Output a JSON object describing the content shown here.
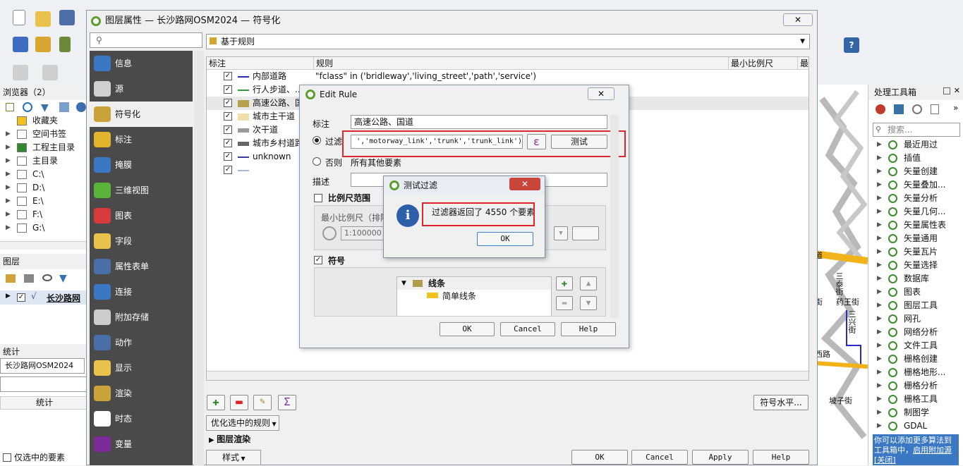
{
  "browser": {
    "title": "浏览器（2）",
    "items": [
      {
        "label": "收藏夹"
      },
      {
        "label": "空间书签"
      },
      {
        "label": "工程主目录"
      },
      {
        "label": "主目录"
      },
      {
        "label": "C:\\"
      },
      {
        "label": "D:\\"
      },
      {
        "label": "E:\\"
      },
      {
        "label": "F:\\"
      },
      {
        "label": "G:\\"
      }
    ]
  },
  "layers": {
    "title": "图层",
    "layer_name": "长沙路网"
  },
  "stats": {
    "title": "统计",
    "layer": "长沙路网OSM2024",
    "column": "统计",
    "only_selected": "仅选中的要素"
  },
  "toolbox": {
    "title": "处理工具箱",
    "search_placeholder": "搜索...",
    "items": [
      "最近用过",
      "插值",
      "矢量创建",
      "矢量叠加...",
      "矢量分析",
      "矢量几何...",
      "矢量属性表",
      "矢量通用",
      "矢量瓦片",
      "矢量选择",
      "数据库",
      "图表",
      "图层工具",
      "网孔",
      "网络分析",
      "文件工具",
      "栅格创建",
      "栅格地形...",
      "栅格分析",
      "栅格工具",
      "制图学",
      "GDAL"
    ],
    "note": "你可以添加更多算法到工具箱中，",
    "note_link": "启用附加源",
    "note_close": "[关闭]"
  },
  "map": {
    "labels": [
      "道",
      "三泰街",
      "药王街",
      "三兴街",
      "街",
      "西路",
      "坡子街"
    ]
  },
  "props": {
    "title": "图层属性 — 长沙路网OSM2024 — 符号化",
    "close": "✕",
    "renderer": "基于规则",
    "sidebar": [
      "信息",
      "源",
      "符号化",
      "标注",
      "掩膜",
      "三维视图",
      "图表",
      "字段",
      "属性表单",
      "连接",
      "附加存储",
      "动作",
      "显示",
      "渲染",
      "时态",
      "变量"
    ],
    "columns": {
      "label": "标注",
      "rule": "规则",
      "min_scale": "最小比例尺",
      "max_scale": "最"
    },
    "rows": [
      {
        "label": "内部道路",
        "rule": "\"fclass\" in ('bridleway','living_street','path','service')",
        "color": "#2b2bb0"
      },
      {
        "label": "行人步道、..",
        "rule": "",
        "color": "#2f9e3a"
      },
      {
        "label": "高速公路、国",
        "rule": "",
        "color": "#b5a24a"
      },
      {
        "label": "城市主干道",
        "rule": "",
        "color": "#efe0a8"
      },
      {
        "label": "次干道",
        "rule": "",
        "color": "#9a9a9a"
      },
      {
        "label": "城市乡村道路",
        "rule": "",
        "color": "#666666"
      },
      {
        "label": "unknown",
        "rule": "",
        "color": "#3b3b9a"
      },
      {
        "label": "",
        "rule": "",
        "color": "#a7b8d8"
      }
    ],
    "refine": "优化选中的规则",
    "layer_render": "图层渲染",
    "symbol_levels": "符号水平...",
    "style": "样式",
    "ok": "OK",
    "cancel": "Cancel",
    "apply": "Apply",
    "help": "Help"
  },
  "edit_rule": {
    "title": "Edit Rule",
    "label_caption": "标注",
    "label_value": "高速公路、国道",
    "filter_caption": "过滤",
    "filter_value": "','motorway_link','trunk','trunk_link')",
    "epsilon": "ε",
    "test": "测试",
    "else_caption": "否则",
    "else_text": "所有其他要素",
    "desc_caption": "描述",
    "scale_title": "比例尺范围",
    "min_scale": "最小比例尺（排除",
    "scale_value": "1:100000",
    "symbol_title": "符号",
    "tree_line": "线条",
    "tree_simple": "简单线条",
    "ok": "OK",
    "cancel": "Cancel",
    "help": "Help"
  },
  "test_dialog": {
    "title": "测试过滤",
    "message": "过滤器返回了 4550 个要素",
    "ok": "OK"
  }
}
